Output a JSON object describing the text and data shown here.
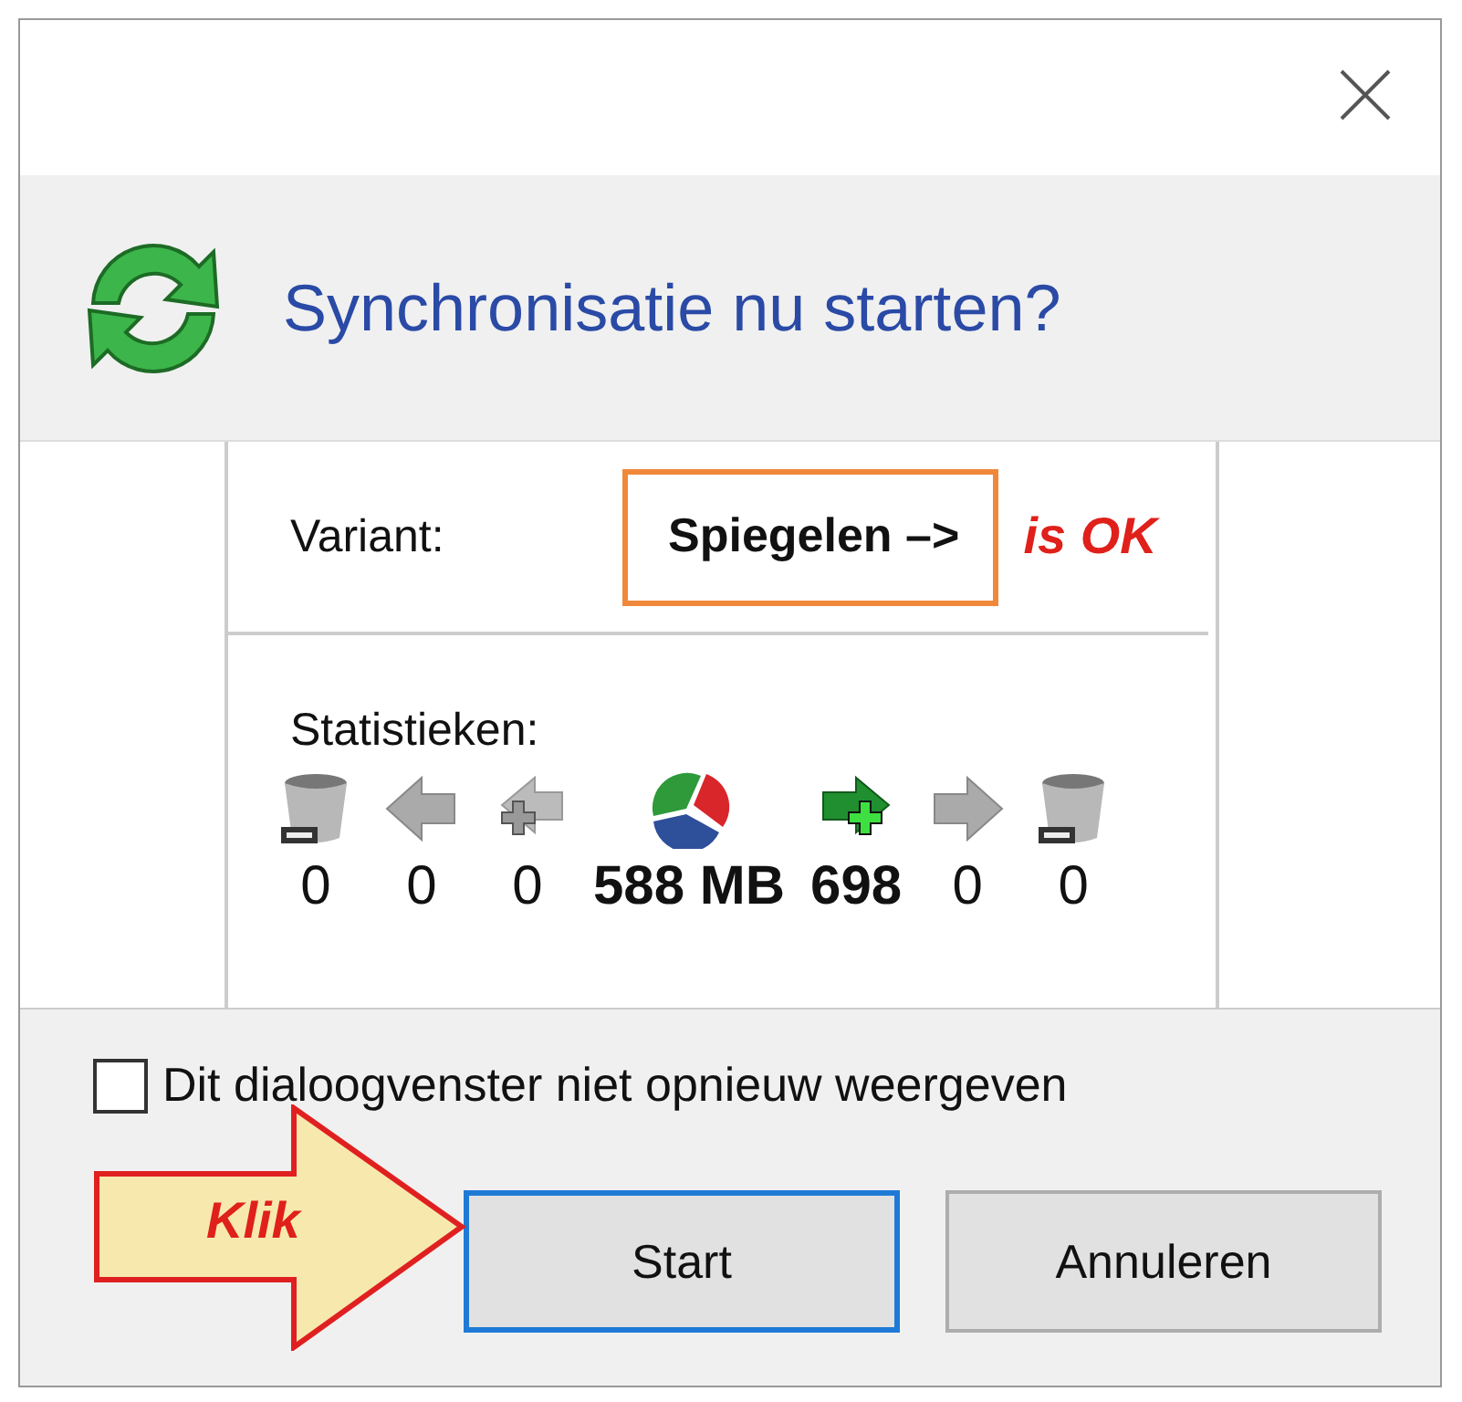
{
  "title": "Synchronisatie nu starten?",
  "variant": {
    "label": "Variant:",
    "value": "Spiegelen –>",
    "highlighted": true,
    "note": "is OK"
  },
  "statistics": {
    "label": "Statistieken:",
    "items": [
      {
        "kind": "bin-minus",
        "value": "0",
        "bold": false
      },
      {
        "kind": "arrow-left",
        "value": "0",
        "bold": false
      },
      {
        "kind": "arrow-left-plus",
        "value": "0",
        "bold": false
      },
      {
        "kind": "pie",
        "value": "588 MB",
        "bold": true
      },
      {
        "kind": "arrow-right-plus",
        "value": "698",
        "bold": true
      },
      {
        "kind": "arrow-right",
        "value": "0",
        "bold": false
      },
      {
        "kind": "bin-minus",
        "value": "0",
        "bold": false
      }
    ]
  },
  "checkbox": {
    "label": "Dit dialoogvenster niet opnieuw weergeven",
    "checked": false
  },
  "buttons": [
    {
      "label": "Start",
      "focused": true
    },
    {
      "label": "Annuleren",
      "focused": false
    }
  ],
  "callout": {
    "label": "Klik"
  }
}
